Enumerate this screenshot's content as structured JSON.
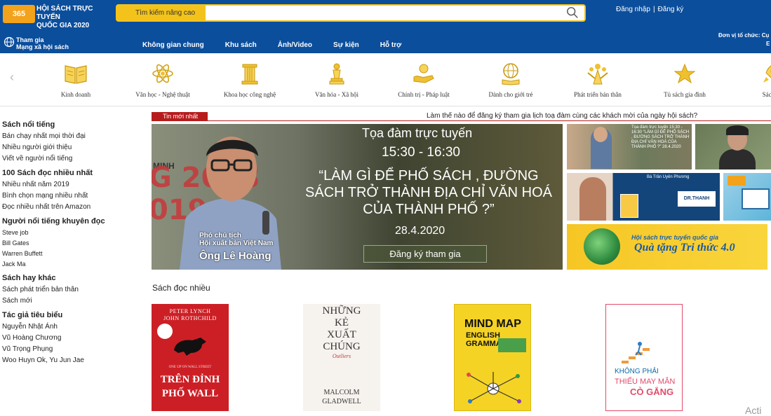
{
  "header": {
    "logo_badge": "365",
    "logo_line1": "HỘI SÁCH TRỰC TUYẾN",
    "logo_line2": "QUỐC GIA 2020",
    "search_advanced": "Tìm kiếm nâng cao",
    "search_placeholder": "",
    "login": "Đăng nhập",
    "register": "Đăng ký",
    "network_line1": "Tham gia",
    "network_line2": "Mạng xã hội sách",
    "org_label": "Đơn vị tổ chức: Cụ",
    "org_tail": "E"
  },
  "nav": {
    "items": [
      "Không gian chung",
      "Khu sách",
      "Ảnh/Video",
      "Sự kiện",
      "Hỗ trợ"
    ]
  },
  "categories": [
    {
      "label": "Kinh doanh",
      "icon": "book-open-icon"
    },
    {
      "label": "Văn học - Nghệ thuật",
      "icon": "atom-icon"
    },
    {
      "label": "Khoa học công nghệ",
      "icon": "column-icon"
    },
    {
      "label": "Văn hóa - Xã hội",
      "icon": "chess-icon"
    },
    {
      "label": "Chính trị - Pháp luật",
      "icon": "hand-icon"
    },
    {
      "label": "Dành cho giới trẻ",
      "icon": "globe-book-icon"
    },
    {
      "label": "Phát triển bản thân",
      "icon": "people-icon"
    },
    {
      "label": "Tủ sách gia đình",
      "icon": "star-icon"
    },
    {
      "label": "Sách th",
      "icon": "rocket-icon"
    }
  ],
  "sidebar": {
    "groups": [
      {
        "title": "Sách nổi tiếng",
        "items": [
          "Bán chạy nhất mọi thời đại",
          "Nhiều người giới thiệu",
          "Viết về người nổi tiếng"
        ]
      },
      {
        "title": "100 Sách đọc nhiều nhất",
        "items": [
          "Nhiều nhất năm 2019",
          "Bình chọn mạng nhiều nhất",
          "Đọc nhiều nhất trên Amazon"
        ]
      },
      {
        "title": "Người nổi tiếng khuyên đọc",
        "items": [
          "Steve job",
          "Bill Gates",
          "Warren Buffett",
          "Jack Ma"
        ]
      },
      {
        "title": "Sách hay khác",
        "items": [
          "Sách phát triển bản thân",
          "Sách mới"
        ]
      },
      {
        "title": "Tác giả tiêu biểu",
        "items": [
          "Nguyễn Nhật Ánh",
          "Vũ Hoàng Chương",
          "Vũ Trọng Phụng",
          "Woo Huyn Ok, Yu Jun Jae"
        ]
      }
    ]
  },
  "ticker": {
    "badge": "Tin mới nhất",
    "text": "Làm thế nào để đăng ký tham gia lịch toạ đàm cùng các khách mời của ngày hội sách?"
  },
  "banner": {
    "title": "Tọa đàm trực tuyến",
    "time": "15:30 - 16:30",
    "quote": "“LÀM GÌ ĐỂ PHỐ SÁCH , ĐƯỜNG SÁCH TRỞ THÀNH ĐỊA CHỈ VĂN HOÁ CỦA THÀNH PHỐ ?”",
    "date": "28.4.2020",
    "cta": "Đăng ký tham gia",
    "role_line1": "Phó chủ tịch",
    "role_line2": "Hội xuất bản Việt Nam",
    "name": "Ông Lê Hoàng",
    "bg_year1": "G 2018",
    "bg_year2": "019",
    "bg_minh": "MINH"
  },
  "thumbs": {
    "t1_text": "Tọa đàm trực tuyến 15:30 - 16:30 “LÀM GÌ ĐỂ PHỐ SÁCH , ĐƯỜNG SÁCH TRỞ THÀNH ĐỊA CHỈ VĂN HOÁ CỦA THÀNH PHỐ ?” 28.4.2020",
    "t3_caption": "Bà Trần Uyên Phương",
    "t3_nameplate": "DR.THANH",
    "t5_title": "Hội sách trực tuyến quốc gia",
    "t5_big": "Quà tặng Tri thức 4.0"
  },
  "books_section": {
    "title": "Sách đọc nhiều",
    "books": [
      {
        "author1": "PETER LYNCH",
        "author2": "JOHN ROTHCHILD",
        "subtitle": "ONE UP ON WALL STREET",
        "title1": "TRÊN ĐỈNH",
        "title2": "PHỐ WALL"
      },
      {
        "title1": "NHỮNG",
        "title2": "KẺ",
        "title3": "XUẤT",
        "title4": "CHÚNG",
        "subtitle": "Outliers",
        "author1": "MALCOLM",
        "author2": "GLADWELL"
      },
      {
        "title1": "MIND MAP",
        "title2": "ENGLISH",
        "title3": "GRAMMAR"
      },
      {
        "title1": "KHÔNG PHẢI",
        "title2": "THIẾU MAY MẮN",
        "title3": "CÒ GẮNG"
      }
    ]
  },
  "watermark": "Acti",
  "colors": {
    "header_bg": "#0b4e9c",
    "search_accent": "#f3c31b",
    "news_red": "#b71c1c",
    "icon_gold": "#e0b020"
  }
}
